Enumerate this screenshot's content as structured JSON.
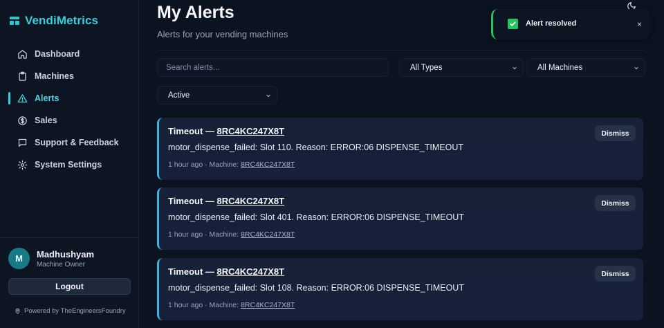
{
  "brand": {
    "name": "VendiMetrics"
  },
  "nav": {
    "items": [
      {
        "label": "Dashboard",
        "icon": "home-icon"
      },
      {
        "label": "Machines",
        "icon": "clipboard-icon"
      },
      {
        "label": "Alerts",
        "icon": "warning-triangle-icon",
        "active": true
      },
      {
        "label": "Sales",
        "icon": "dollar-circle-icon"
      },
      {
        "label": "Support & Feedback",
        "icon": "chat-icon"
      },
      {
        "label": "System Settings",
        "icon": "gear-icon"
      }
    ]
  },
  "user": {
    "initial": "M",
    "name": "Madhushyam",
    "role": "Machine Owner"
  },
  "logout_label": "Logout",
  "powered_by": "Powered by TheEngineersFoundry",
  "page": {
    "title": "My Alerts",
    "subtitle": "Alerts for your vending machines"
  },
  "filters": {
    "search_placeholder": "Search alerts...",
    "type": "All Types",
    "machine": "All Machines",
    "status": "Active"
  },
  "alerts": [
    {
      "type": "Timeout — ",
      "machine": "8RC4KC247X8T",
      "message": "motor_dispense_failed: Slot 110. Reason: ERROR:06 DISPENSE_TIMEOUT",
      "time": "1 hour ago · Machine: ",
      "dismiss": "Dismiss"
    },
    {
      "type": "Timeout — ",
      "machine": "8RC4KC247X8T",
      "message": "motor_dispense_failed: Slot 401. Reason: ERROR:06 DISPENSE_TIMEOUT",
      "time": "1 hour ago · Machine: ",
      "dismiss": "Dismiss"
    },
    {
      "type": "Timeout — ",
      "machine": "8RC4KC247X8T",
      "message": "motor_dispense_failed: Slot 108. Reason: ERROR:06 DISPENSE_TIMEOUT",
      "time": "1 hour ago · Machine: ",
      "dismiss": "Dismiss"
    }
  ],
  "toast": {
    "text": "Alert resolved",
    "close": "×"
  },
  "colors": {
    "accent": "#35d0dc",
    "card_border": "#35b8e8",
    "success": "#22c55e",
    "background": "#0b1220"
  }
}
